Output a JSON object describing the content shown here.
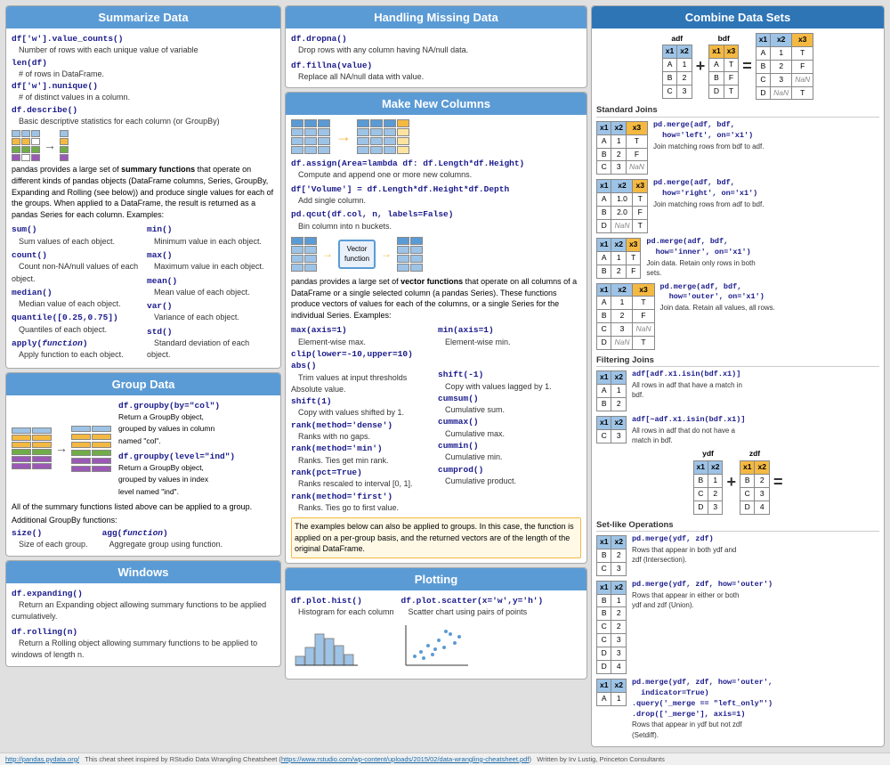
{
  "sections": {
    "summarize": {
      "title": "Summarize Data",
      "items": [
        {
          "code": "df['w'].value_counts()",
          "desc": "Number of rows with each unique value of variable"
        },
        {
          "code": "len(df)",
          "desc": "# of rows in DataFrame."
        },
        {
          "code": "df['w'].nunique()",
          "desc": "# of distinct values in a column."
        },
        {
          "code": "df.describe()",
          "desc": "Basic descriptive statistics for each column (or GroupBy)"
        }
      ],
      "summary_text": "pandas provides a large set of summary functions that operate on different kinds of pandas objects (DataFrame columns, Series, GroupBy, Expanding and Rolling (see below)) and produce single values for each of the groups. When applied to a DataFrame, the result is returned as a pandas Series for each column. Examples:",
      "agg_functions_left": [
        {
          "code": "sum()",
          "desc": "Sum values of each object."
        },
        {
          "code": "count()",
          "desc": "Count non-NA/null values of each object."
        },
        {
          "code": "median()",
          "desc": "Median value of each object."
        },
        {
          "code": "quantile([0.25,0.75])",
          "desc": "Quantiles of each object."
        },
        {
          "code": "apply(function)",
          "desc": "Apply function to each object."
        }
      ],
      "agg_functions_right": [
        {
          "code": "min()",
          "desc": "Minimum value in each object."
        },
        {
          "code": "max()",
          "desc": "Maximum value in each object."
        },
        {
          "code": "mean()",
          "desc": "Mean value of each object."
        },
        {
          "code": "var()",
          "desc": "Variance of each object."
        },
        {
          "code": "std()",
          "desc": "Standard deviation of each object."
        }
      ]
    },
    "group": {
      "title": "Group Data",
      "items": [
        {
          "code": "df.groupby(by=\"col\")",
          "desc": "Return a GroupBy object, grouped by values in column named \"col\"."
        },
        {
          "code": "df.groupby(level=\"ind\")",
          "desc": "Return a GroupBy object, grouped by values in index level named \"ind\"."
        }
      ],
      "summary_text": "All of the summary functions listed above can be applied to a group.",
      "additional_text": "Additional GroupBy functions:",
      "extra_functions": [
        {
          "code": "size()",
          "desc": "Size of each group."
        },
        {
          "code": "agg(function)",
          "desc": "Aggregate group using function."
        }
      ]
    },
    "windows": {
      "title": "Windows",
      "items": [
        {
          "code": "df.expanding()",
          "desc": "Return an Expanding object allowing summary functions to be applied cumulatively."
        },
        {
          "code": "df.rolling(n)",
          "desc": "Return a Rolling object allowing summary functions to be applied to windows of length n."
        }
      ]
    },
    "handling_missing": {
      "title": "Handling Missing Data",
      "items": [
        {
          "code": "df.dropna()",
          "desc": "Drop rows with any column having NA/null data."
        },
        {
          "code": "df.fillna(value)",
          "desc": "Replace all NA/null data with value."
        }
      ]
    },
    "make_new_columns": {
      "title": "Make New Columns",
      "items": [
        {
          "code": "df.assign(Area=lambda df: df.Length*df.Height)",
          "desc": "Compute and append one or more new columns."
        },
        {
          "code": "df['Volume'] = df.Length*df.Height*df.Depth",
          "desc": "Add single column."
        },
        {
          "code": "pd.qcut(df.col, n, labels=False)",
          "desc": "Bin column into n buckets."
        }
      ],
      "vector_text": "pandas provides a large set of vector functions that operate on all columns of a DataFrame or a single selected column (a pandas Series). These functions produce vectors of values for each of the columns, or a single Series for the individual Series. Examples:",
      "vector_functions_left": [
        {
          "code": "max(axis=1)",
          "desc": "Element-wise max."
        },
        {
          "code": "clip(lower=-10,upper=10)",
          "desc": "Trim values at input thresholds"
        },
        {
          "code": "shift(1)",
          "desc": "Copy with values shifted by 1."
        },
        {
          "code": "rank(method='dense')",
          "desc": "Ranks with no gaps."
        },
        {
          "code": "rank(method='min')",
          "desc": "Ranks. Ties get min rank."
        },
        {
          "code": "rank(pct=True)",
          "desc": "Ranks rescaled to interval [0, 1]."
        },
        {
          "code": "rank(method='first')",
          "desc": "Ranks. Ties go to first value."
        }
      ],
      "vector_functions_right": [
        {
          "code": "min(axis=1)",
          "desc": "Element-wise min."
        },
        {
          "code": "abs()",
          "desc": "Absolute value."
        },
        {
          "code": "shift(-1)",
          "desc": "Copy with values lagged by 1."
        },
        {
          "code": "cumsum()",
          "desc": "Cumulative sum."
        },
        {
          "code": "cummax()",
          "desc": "Cumulative max."
        },
        {
          "code": "cummin()",
          "desc": "Cumulative min."
        },
        {
          "code": "cumprod()",
          "desc": "Cumulative product."
        }
      ],
      "group_note": "The examples below can also be applied to groups. In this case, the function is applied on a per-group basis, and the returned vectors are of the length of the original DataFrame."
    },
    "plotting": {
      "title": "Plotting",
      "items": [
        {
          "code": "df.plot.hist()",
          "desc": "Histogram for each column"
        },
        {
          "code": "df.plot.scatter(x='w',y='h')",
          "desc": "Scatter chart using pairs of points"
        }
      ]
    },
    "combine": {
      "title": "Combine Data Sets",
      "standard_joins_label": "Standard Joins",
      "filtering_joins_label": "Filtering Joins",
      "set_ops_label": "Set-like Operations",
      "joins": [
        {
          "code": "pd.merge(adf, bdf,\n  how='left', on='x1')",
          "desc": "Join matching rows from bdf to adf."
        },
        {
          "code": "pd.merge(adf, bdf,\n  how='right', on='x1')",
          "desc": "Join matching rows from adf to bdf."
        },
        {
          "code": "pd.merge(adf, bdf,\n  how='inner', on='x1')",
          "desc": "Join data. Retain only rows in both sets."
        },
        {
          "code": "pd.merge(adf, bdf,\n  how='outer', on='x1')",
          "desc": "Join data. Retain all values, all rows."
        }
      ],
      "filter_joins": [
        {
          "code": "adf[adf.x1.isin(bdf.x1)]",
          "desc": "All rows in adf that have a match in bdf."
        },
        {
          "code": "adf[~adf.x1.isin(bdf.x1)]",
          "desc": "All rows in adf that do not have a match in bdf."
        }
      ],
      "set_ops": [
        {
          "code": "pd.merge(ydf, zdf)",
          "desc": "Rows that appear in both ydf and zdf (Intersection)."
        },
        {
          "code": "pd.merge(ydf, zdf, how='outer')",
          "desc": "Rows that appear in either or both ydf and zdf (Union)."
        },
        {
          "code": "pd.merge(ydf, zdf, how='outer',\n  indicator=True)\n.query('_merge == \"left_only\"')\n.drop(['_merge'], axis=1)",
          "desc": "Rows that appear in ydf but not zdf (Setdiff)."
        }
      ]
    }
  },
  "footer": {
    "link1_text": "http://pandas.pydata.org/",
    "link1_label": "http://pandas.pydata.org/",
    "text1": "This cheat sheet inspired by RStudio Data Wrangling Cheatsheet",
    "link2_text": "https://www.rstudio.com/wp-content/uploads/2015/02/data-wrangling-cheatsheet.pdf",
    "link2_label": "https://www.rstudio.com/wp-content/uploads/2015/02/data-wrangling-cheatsheet.pdf",
    "author": "Written by Irv Lustig, Princeton Consultants"
  }
}
